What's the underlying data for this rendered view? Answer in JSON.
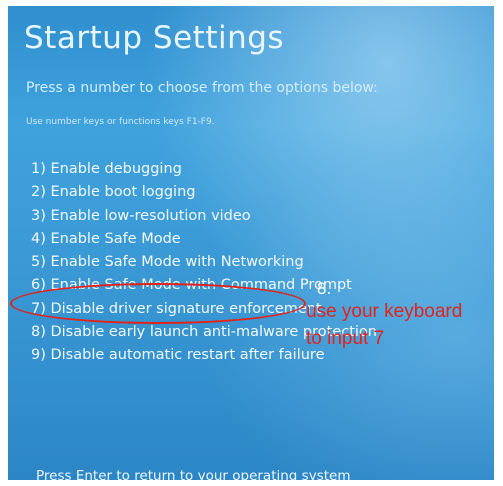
{
  "screen": {
    "title": "Startup Settings",
    "subtitle": "Press a number to choose from the options below:",
    "hint": "Use number keys or functions keys F1-F9.",
    "options": [
      "1) Enable debugging",
      "2) Enable boot logging",
      "3) Enable low-resolution video",
      "4) Enable Safe Mode",
      "5) Enable Safe Mode with Networking",
      "6) Enable Safe Mode with Command Prompt",
      "7) Disable driver signature enforcement",
      "8) Disable early launch anti-malware protection",
      "9) Disable automatic restart after failure"
    ],
    "footer": "Press Enter to return to your operating system"
  },
  "annotation": {
    "step_number": "8.",
    "line1": "use your keyboard",
    "line2": "to input 7",
    "color": "#e2231a"
  }
}
